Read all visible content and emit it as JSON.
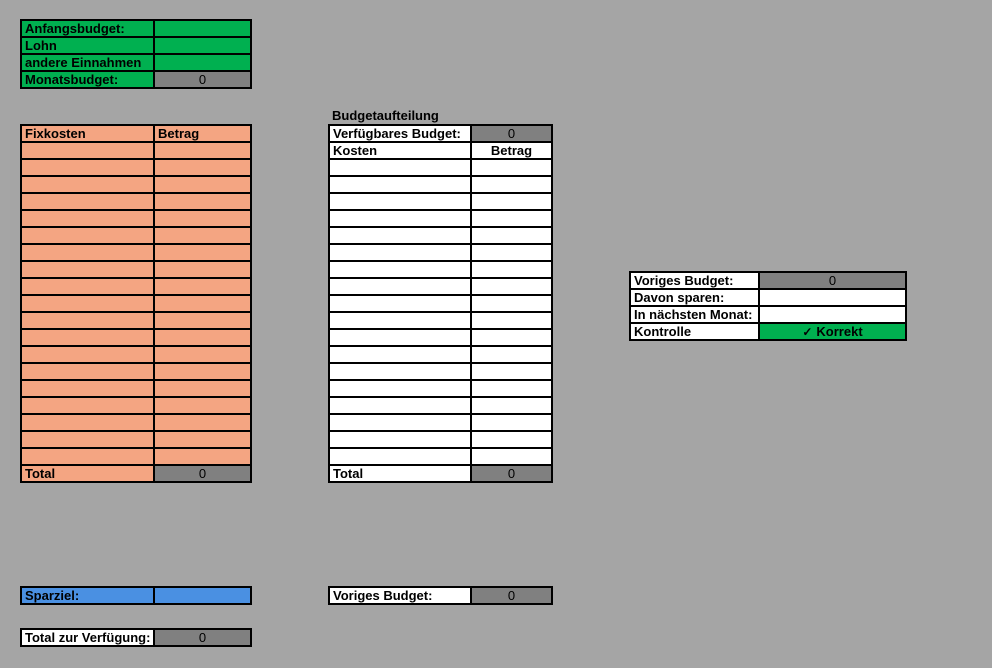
{
  "income": {
    "rows": [
      {
        "label": "Anfangsbudget:",
        "value": ""
      },
      {
        "label": "Lohn",
        "value": ""
      },
      {
        "label": "andere Einnahmen",
        "value": ""
      }
    ],
    "monthly_label": "Monatsbudget:",
    "monthly_value": "0"
  },
  "fixed_costs": {
    "header_label": "Fixkosten",
    "header_amount": "Betrag",
    "total_label": "Total",
    "total_value": "0"
  },
  "savings": {
    "label": "Sparziel:",
    "value": ""
  },
  "available": {
    "label": "Total zur Verfügung:",
    "value": "0"
  },
  "budget_split": {
    "title": "Budgetaufteilung",
    "available_label": "Verfügbares Budget:",
    "available_value": "0",
    "header_costs": "Kosten",
    "header_amount": "Betrag",
    "total_label": "Total",
    "total_value": "0"
  },
  "previous": {
    "label": "Voriges Budget:",
    "value": "0"
  },
  "control": {
    "previous_label": "Voriges Budget:",
    "previous_value": "0",
    "save_label": "Davon sparen:",
    "save_value": "",
    "next_label": "In nächsten Monat:",
    "next_value": "",
    "check_label": "Kontrolle",
    "check_icon": "✓",
    "check_value": "Korrekt"
  },
  "colors": {
    "background": "#a5a5a5",
    "green": "#00b050",
    "gray": "#808080",
    "salmon": "#f4a582",
    "blue": "#4a90e2"
  }
}
